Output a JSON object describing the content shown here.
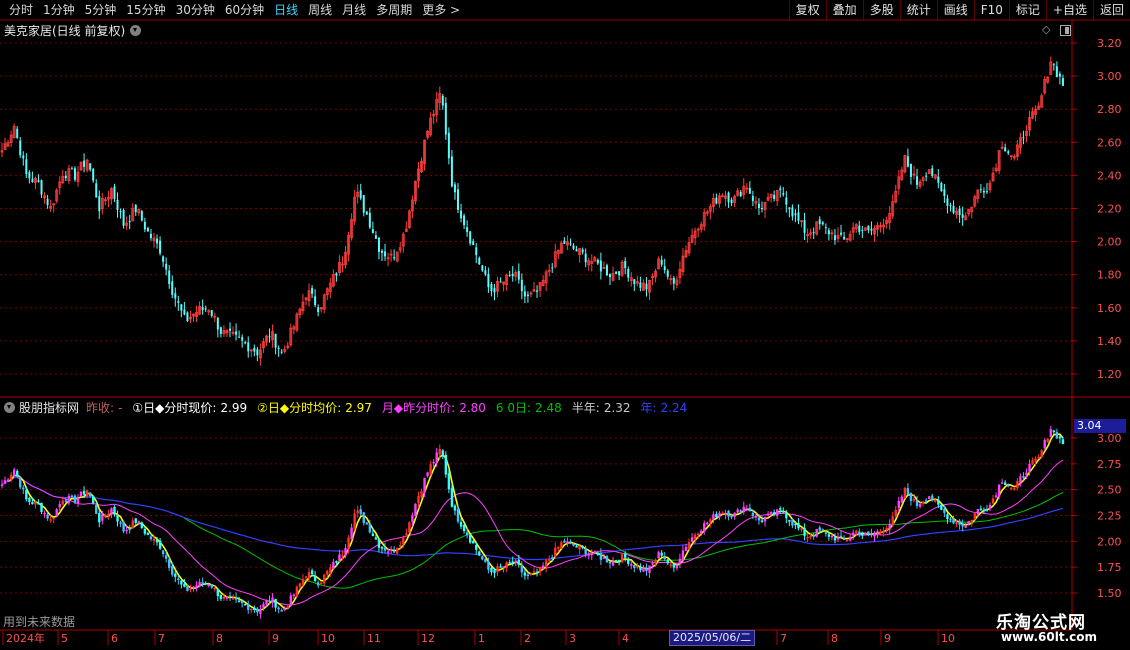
{
  "toolbar": {
    "timeframes": [
      "分时",
      "1分钟",
      "5分钟",
      "15分钟",
      "30分钟",
      "60分钟",
      "日线",
      "周线",
      "月线",
      "多周期",
      "更多 >"
    ],
    "active_index": 6,
    "tools": [
      "复权",
      "叠加",
      "多股",
      "统计",
      "画线",
      "F10",
      "标记",
      "+自选",
      "返回"
    ]
  },
  "main_panel": {
    "title": "美克家居(日线 前复权)",
    "y_ticks": [
      "3.20",
      "3.00",
      "2.80",
      "2.60",
      "2.40",
      "2.20",
      "2.00",
      "1.80",
      "1.60",
      "1.40",
      "1.20"
    ]
  },
  "indicator_panel": {
    "name": "股朋指标网",
    "prev_close_label": "昨收:",
    "prev_close_value": "-",
    "items": [
      {
        "label": "①日◆分时现价:",
        "value": "2.99",
        "color": "#ffffff"
      },
      {
        "label": "②日◆分时均价:",
        "value": "2.97",
        "color": "#ffff00"
      },
      {
        "label": "月◆昨分时价:",
        "value": "2.80",
        "color": "#ff40ff"
      },
      {
        "label": "6 0日:",
        "value": "2.48",
        "color": "#00c000"
      },
      {
        "label": "半年:",
        "value": "2.32",
        "color": "#c8c8c8"
      },
      {
        "label": "年:",
        "value": "2.24",
        "color": "#3040ff"
      }
    ],
    "current_price": "3.04",
    "y_ticks": [
      "3.00",
      "2.75",
      "2.50",
      "2.25",
      "2.00",
      "1.75",
      "1.50"
    ],
    "future_note": "用到未来数据"
  },
  "x_axis": {
    "labels": [
      "2024年",
      "5",
      "6",
      "7",
      "8",
      "9",
      "10",
      "11",
      "12",
      "1",
      "2",
      "3",
      "4",
      "5",
      "6",
      "7",
      "8",
      "9",
      "10"
    ],
    "selected_date": "2025/05/06/二"
  },
  "watermark": {
    "line1": "乐淘公式网",
    "line2": "www.60lt.com"
  },
  "colors": {
    "up": "#ff3c3c",
    "down": "#54ffff",
    "grid": "#7a0000",
    "axis": "#b00000",
    "ma_yellow": "#ffff00",
    "ma_magenta": "#ff40ff",
    "ma_green": "#00c000",
    "ma_blue": "#3040ff"
  },
  "chart_data": {
    "type": "candlestick",
    "close_trajectory": [
      2.55,
      2.7,
      2.4,
      2.35,
      2.2,
      2.42,
      2.4,
      2.5,
      2.2,
      2.32,
      2.1,
      2.2,
      2.05,
      1.95,
      1.7,
      1.52,
      1.58,
      1.6,
      1.45,
      1.42,
      1.38,
      1.33,
      1.45,
      1.32,
      1.5,
      1.7,
      1.6,
      1.75,
      1.9,
      2.3,
      2.15,
      1.95,
      1.9,
      2.05,
      2.4,
      2.7,
      2.9,
      2.3,
      2.1,
      1.9,
      1.7,
      1.75,
      1.8,
      1.65,
      1.7,
      1.85,
      2.0,
      1.95,
      1.9,
      1.85,
      1.8,
      1.85,
      1.75,
      1.72,
      1.9,
      1.72,
      1.95,
      2.1,
      2.2,
      2.3,
      2.25,
      2.35,
      2.2,
      2.25,
      2.3,
      2.15,
      2.05,
      2.1,
      2.05,
      2.0,
      2.1,
      2.05,
      2.1,
      2.2,
      2.5,
      2.35,
      2.45,
      2.3,
      2.2,
      2.15,
      2.3,
      2.35,
      2.6,
      2.5,
      2.7,
      2.8,
      3.1,
      2.95
    ]
  }
}
